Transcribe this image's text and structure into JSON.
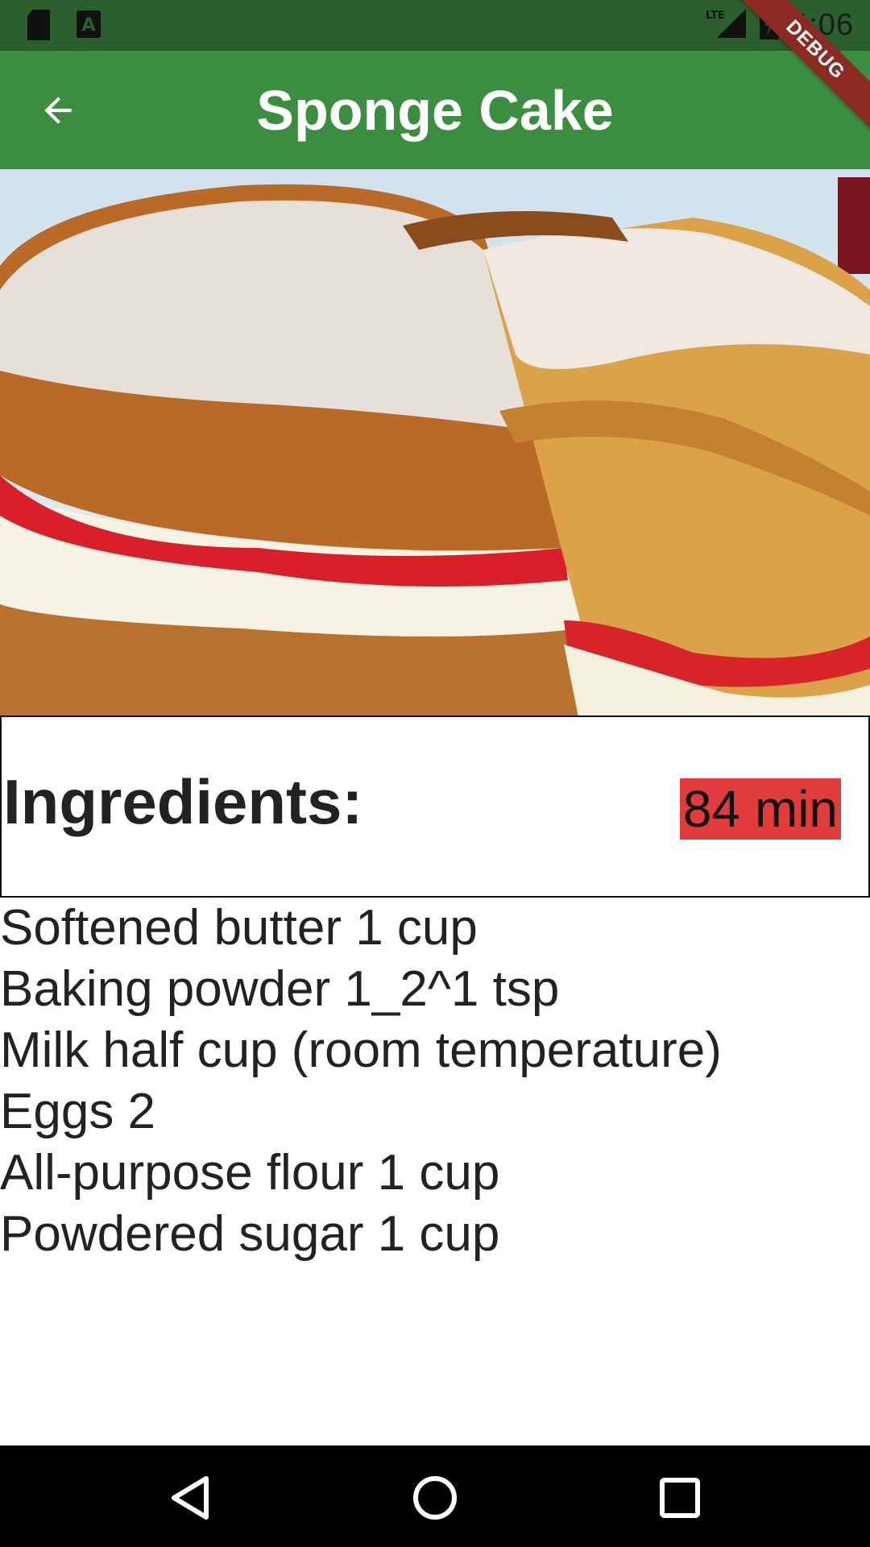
{
  "status_bar": {
    "time": "4:06",
    "icons": [
      "sd-card-icon",
      "text-a-icon",
      "lte-signal-icon",
      "battery-charging-icon"
    ],
    "network_label": "LTE"
  },
  "debug_banner": "DEBUG",
  "app_bar": {
    "title": "Sponge Cake",
    "back_icon": "arrow-back-icon",
    "background": "#3b8d40"
  },
  "hero_image": {
    "subject": "sponge cake with jam and cream filling"
  },
  "ingredients": {
    "heading": "Ingredients:",
    "time": "84 min",
    "badge_color": "#e03c3c",
    "items": [
      "Softened butter 1 cup",
      "Baking powder 1_2^1 tsp",
      "Milk half cup (room temperature)",
      "Eggs 2",
      "All-purpose flour 1 cup",
      "Powdered sugar 1 cup"
    ]
  },
  "nav_bar": {
    "buttons": [
      "back-triangle-icon",
      "home-circle-icon",
      "recents-square-icon"
    ]
  }
}
